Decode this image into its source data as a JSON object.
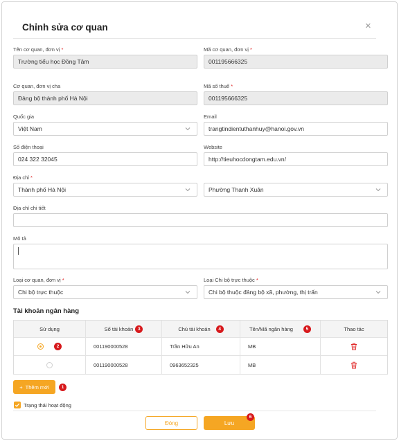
{
  "dialog": {
    "title": "Chỉnh sửa cơ quan",
    "close_glyph": "×"
  },
  "form": {
    "org_name": {
      "label": "Tên cơ quan, đơn vị",
      "value": "Trường tiểu học Đồng Tâm"
    },
    "org_code": {
      "label": "Mã cơ quan, đơn vị",
      "value": "001195666325"
    },
    "parent_org": {
      "label": "Cơ quan, đơn vị cha",
      "value": "Đảng bộ thành phố Hà Nội"
    },
    "tax_code": {
      "label": "Mã số thuế",
      "value": "001195666325"
    },
    "country": {
      "label": "Quốc gia",
      "value": "Việt Nam"
    },
    "email": {
      "label": "Email",
      "value": "trangtindientuthanhuy@hanoi.gov.vn"
    },
    "phone": {
      "label": "Số điện thoại",
      "value": "024 322 32045"
    },
    "website": {
      "label": "Website",
      "value": "http://tieuhocdongtam.edu.vn/"
    },
    "address": {
      "label": "Địa chỉ",
      "city": "Thành phố Hà Nội",
      "ward": "Phường Thanh Xuân"
    },
    "address_detail": {
      "label": "Địa chỉ chi tiết",
      "value": ""
    },
    "description": {
      "label": "Mô tả",
      "value": ""
    },
    "org_type": {
      "label": "Loại cơ quan, đơn vị",
      "value": "Chi bộ trực thuộc"
    },
    "branch_type": {
      "label": "Loại Chi bộ trực thuộc",
      "value": "Chi bộ thuộc đảng bộ xã, phường, thị trấn"
    },
    "required_mark": "*"
  },
  "bank": {
    "section_title": "Tài khoản ngân hàng",
    "headers": [
      "Sử dụng",
      "Số tài khoản",
      "Chủ tài khoản",
      "Tên/Mã ngân hàng",
      "Thao tác"
    ],
    "rows": [
      {
        "selected": true,
        "account_no": "001190000528",
        "holder": "Trần Hữu An",
        "bank": "MB"
      },
      {
        "selected": false,
        "account_no": "001190000528",
        "holder": "0963652325",
        "bank": "MB"
      }
    ],
    "add_label": "Thêm mới",
    "add_glyph": "+"
  },
  "status": {
    "label": "Trạng thái hoạt động",
    "checked": true
  },
  "footer": {
    "close_label": "Đóng",
    "save_label": "Lưu"
  },
  "badges": [
    "1",
    "2",
    "3",
    "4",
    "5",
    "6"
  ],
  "colors": {
    "accent": "#f5a623",
    "badge": "#d7191c",
    "delete": "#e02424",
    "readonly_bg": "#ebebeb"
  },
  "icons": {
    "dropdown": "chevron-down-icon",
    "delete": "trash-icon",
    "close": "close-icon",
    "check": "check-icon"
  }
}
